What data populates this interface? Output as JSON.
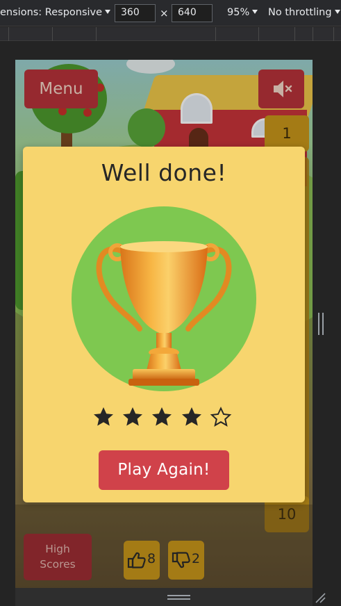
{
  "devtools": {
    "dimensions_label": "ensions: Responsive",
    "width_value": "360",
    "times": "×",
    "height_value": "640",
    "zoom": "95%",
    "throttling": "No throttling"
  },
  "game": {
    "menu_label": "Menu",
    "mute_icon": "speaker-muted-icon",
    "level_tiles": [
      "1",
      "10"
    ],
    "high_scores_line1": "High",
    "high_scores_line2": "Scores",
    "likes_count": "8",
    "dislikes_count": "2"
  },
  "modal": {
    "title": "Well done!",
    "stars_filled": 4,
    "stars_total": 5,
    "play_again_label": "Play Again!",
    "trophy_icon": "trophy-icon"
  },
  "colors": {
    "modal_bg": "#f7d56e",
    "button_red": "#d0424a",
    "circle_green": "#7ec850",
    "tile_gold": "#c9961a"
  }
}
